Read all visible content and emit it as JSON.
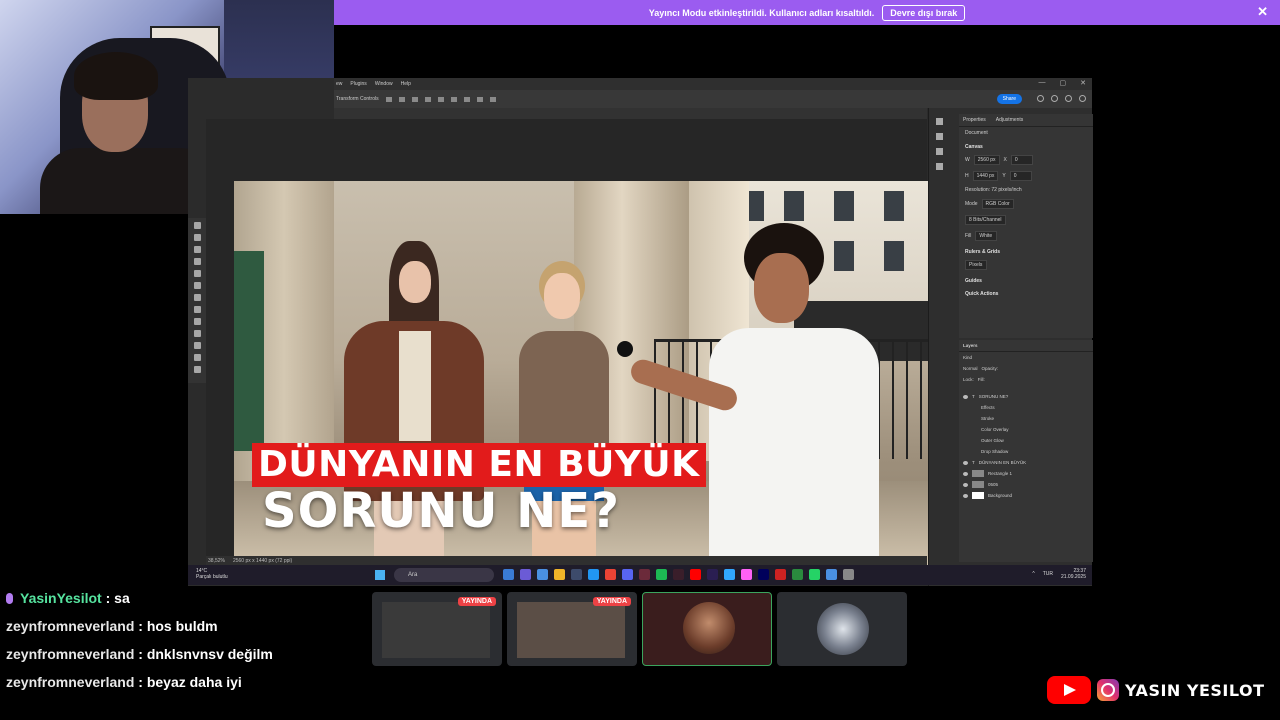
{
  "banner": {
    "message": "Yayıncı Modu etkinleştirildi. Kullanıcı adları kısaltıldı.",
    "button": "Devre dışı bırak",
    "close": "✕"
  },
  "photoshop": {
    "menu": [
      "ew",
      "Plugins",
      "Window",
      "Help"
    ],
    "window_controls": [
      "—",
      "▢",
      "✕"
    ],
    "options_label": "Transform Controls",
    "share_label": "Share",
    "status_zoom": "38,52%",
    "status_size": "2560 px x 1440 px (72 ppi)",
    "canvas_text": {
      "line1": "DÜNYANIN EN BÜYÜK",
      "line2": "SORUNU NE?"
    },
    "properties": {
      "tab1": "Properties",
      "tab2": "Adjustments",
      "doc_label": "Document",
      "canvas_section": "Canvas",
      "width_label": "W",
      "width_value": "2560 px",
      "x_label": "X",
      "x_value": "0",
      "height_label": "H",
      "height_value": "1440 px",
      "y_label": "Y",
      "y_value": "0",
      "resolution": "Resolution: 72 pixels/inch",
      "mode_label": "Mode",
      "mode_value": "RGB Color",
      "depth_value": "8 Bits/Channel",
      "fill_label": "Fill",
      "fill_value": "White",
      "rulers_section": "Rulers & Grids",
      "units_value": "Pixels",
      "guides_section": "Guides",
      "quick_actions": "Quick Actions"
    },
    "layers": {
      "title": "Layers",
      "kind": "Kind",
      "blend": "Normal",
      "opacity": "Opacity:",
      "lock": "Lock:",
      "fill": "Fill:",
      "items": [
        {
          "name": "SORUNU NE?",
          "type": "T"
        },
        {
          "name": "Effects",
          "type": "sub"
        },
        {
          "name": "Stroke",
          "type": "sub2"
        },
        {
          "name": "Color Overlay",
          "type": "sub2"
        },
        {
          "name": "Outer Glow",
          "type": "sub2"
        },
        {
          "name": "Drop Shadow",
          "type": "sub2"
        },
        {
          "name": "DÜNYANIN EN BÜYÜK",
          "type": "T"
        },
        {
          "name": "Rectangle 1",
          "type": "img"
        },
        {
          "name": "0505",
          "type": "img"
        },
        {
          "name": "Background",
          "type": "img"
        }
      ]
    }
  },
  "taskbar": {
    "temp": "14°C",
    "weather": "Parçalı bulutlu",
    "search_placeholder": "Ara",
    "language": "TUR",
    "time": "23:37",
    "date": "21.09.2025",
    "app_colors": [
      "#3a7bd5",
      "#6b5bd6",
      "#4a90e2",
      "#f0b429",
      "#3d4b6b",
      "#2196f3",
      "#ea4335",
      "#5865f2",
      "#6b2a3a",
      "#1db954",
      "#3a1e2a",
      "#ff0000",
      "#2a1e52",
      "#31a8ff",
      "#ff61f6",
      "#00005b",
      "#cc2222",
      "#2a8a3e",
      "#25d366",
      "#4a90e2",
      "#888888"
    ]
  },
  "streams": [
    {
      "label": "YAYINDA",
      "live": true
    },
    {
      "label": "YAYINDA",
      "live": true
    },
    {
      "label": "",
      "live": false
    },
    {
      "label": "",
      "live": false
    }
  ],
  "chat": [
    {
      "user": "YasinYesilot",
      "message": "sa",
      "highlight": true
    },
    {
      "user": "zeynfromneverland",
      "message": "hos buldm",
      "highlight": false
    },
    {
      "user": "zeynfromneverland",
      "message": "dnklsnvnsv değilm",
      "highlight": false
    },
    {
      "user": "zeynfromneverland",
      "message": "beyaz daha iyi",
      "highlight": false
    }
  ],
  "social": {
    "name": "YASIN YESILOT",
    "icons": [
      "youtube-icon",
      "instagram-icon"
    ]
  }
}
